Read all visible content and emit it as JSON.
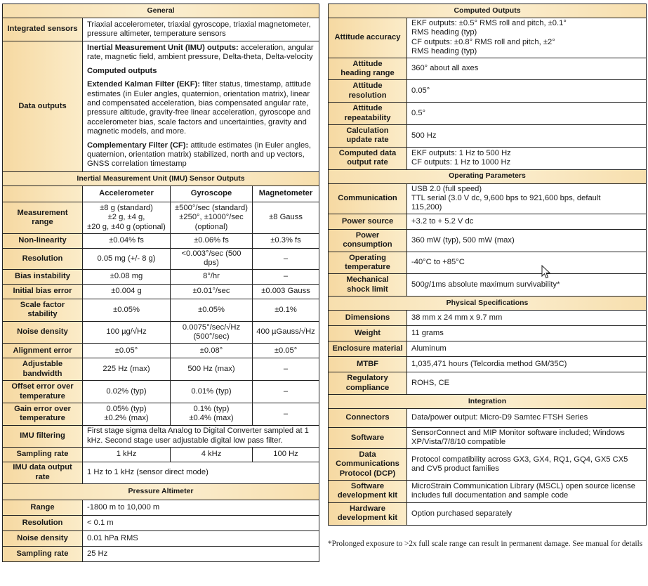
{
  "left": {
    "general": {
      "title": "General",
      "integrated_sensors": {
        "label": "Integrated sensors",
        "value": "Triaxial accelerometer, triaxial gyroscope, triaxial magnetometer, pressure altimeter, temperature sensors"
      },
      "data_outputs": {
        "label": "Data outputs",
        "imu_bold": "Inertial Measurement Unit (IMU) outputs:",
        "imu_text": " acceleration, angular rate, magnetic field, ambient pressure, Delta-theta, Delta-velocity",
        "computed_heading": "Computed outputs",
        "ekf_bold": "Extended Kalman Filter (EKF):",
        "ekf_text": " filter status, timestamp, attitude estimates (in Euler angles, quaternion, orientation matrix), linear and compensated acceleration, bias compensated angular rate, pressure altitude, gravity-free linear acceleration, gyroscope and accelerometer bias, scale factors and uncertainties, gravity and magnetic models, and more.",
        "cf_bold": "Complementary Filter (CF):",
        "cf_text": " attitude estimates (in Euler angles, quaternion, orientation matrix) stabilized, north and up vectors, GNSS correlation timestamp"
      }
    },
    "imu": {
      "title": "Inertial Measurement Unit (IMU) Sensor Outputs",
      "columns": [
        "Accelerometer",
        "Gyroscope",
        "Magnetometer"
      ],
      "rows": [
        {
          "label": "Measurement range",
          "acc": "±8 g (standard)\n±2 g, ±4 g,\n±20 g, ±40 g (optional)",
          "gyro": "±500°/sec (standard)\n±250°, ±1000°/sec\n(optional)",
          "mag": "±8 Gauss"
        },
        {
          "label": "Non-linearity",
          "acc": "±0.04% fs",
          "gyro": "±0.06% fs",
          "mag": "±0.3% fs"
        },
        {
          "label": "Resolution",
          "acc": "0.05 mg (+/- 8 g)",
          "gyro": "<0.003°/sec (500 dps)",
          "mag": "–"
        },
        {
          "label": "Bias instability",
          "acc": "±0.08 mg",
          "gyro": "8°/hr",
          "mag": "–"
        },
        {
          "label": "Initial bias error",
          "acc": "±0.004 g",
          "gyro": "±0.01°/sec",
          "mag": "±0.003 Gauss"
        },
        {
          "label": "Scale factor\nstability",
          "acc": "±0.05%",
          "gyro": "±0.05%",
          "mag": "±0.1%"
        },
        {
          "label": "Noise density",
          "acc": "100 µg/√Hz",
          "gyro": "0.0075°/sec/√Hz\n(500°/sec)",
          "mag": "400 µGauss/√Hz"
        },
        {
          "label": "Alignment error",
          "acc": "±0.05°",
          "gyro": "±0.08°",
          "mag": "±0.05°"
        },
        {
          "label": "Adjustable\nbandwidth",
          "acc": "225 Hz (max)",
          "gyro": "500 Hz (max)",
          "mag": "–"
        },
        {
          "label": "Offset error over\ntemperature",
          "acc": "0.02% (typ)",
          "gyro": "0.01% (typ)",
          "mag": "–"
        },
        {
          "label": "Gain error over\ntemperature",
          "acc": "0.05% (typ)\n±0.2% (max)",
          "gyro": "0.1% (typ)\n±0.4% (max)",
          "mag": "–"
        }
      ],
      "filtering": {
        "label": "IMU filtering",
        "value": "First stage sigma delta Analog to Digital Converter sampled at 1 kHz. Second stage user adjustable digital low pass filter."
      },
      "sampling": {
        "label": "Sampling rate",
        "acc": "1 kHz",
        "gyro": "4 kHz",
        "mag": "100 Hz"
      },
      "output_rate": {
        "label": "IMU data output\nrate",
        "value": "1 Hz to 1 kHz (sensor direct mode)"
      }
    },
    "pressure": {
      "title": "Pressure Altimeter",
      "rows": [
        {
          "label": "Range",
          "value": "-1800 m to 10,000 m"
        },
        {
          "label": "Resolution",
          "value": "< 0.1 m"
        },
        {
          "label": "Noise density",
          "value": "0.01 hPa RMS"
        },
        {
          "label": "Sampling rate",
          "value": "25 Hz"
        }
      ]
    }
  },
  "right": {
    "computed": {
      "title": "Computed Outputs",
      "rows": [
        {
          "label": "Attitude accuracy",
          "value": "EKF outputs: ±0.5° RMS roll and pitch, ±0.1°\nRMS heading (typ)\nCF outputs: ±0.8° RMS roll and pitch, ±2°\nRMS heading (typ)"
        },
        {
          "label": "Attitude\nheading range",
          "value": "360° about all axes"
        },
        {
          "label": "Attitude\nresolution",
          "value": "0.05°"
        },
        {
          "label": "Attitude\nrepeatability",
          "value": "0.5°"
        },
        {
          "label": "Calculation\nupdate rate",
          "value": "500 Hz"
        },
        {
          "label": "Computed data\noutput rate",
          "value": "EKF outputs: 1 Hz to 500 Hz\nCF outputs: 1 Hz to 1000 Hz"
        }
      ]
    },
    "operating": {
      "title": "Operating Parameters",
      "rows": [
        {
          "label": "Communication",
          "value": "USB 2.0 (full speed)\nTTL serial (3.0 V dc, 9,600 bps to 921,600 bps, default\n115,200)"
        },
        {
          "label": "Power source",
          "value": "+3.2 to + 5.2 V dc"
        },
        {
          "label": "Power\nconsumption",
          "value": "360 mW (typ), 500 mW (max)"
        },
        {
          "label": "Operating\ntemperature",
          "value": "-40°C to +85°C"
        },
        {
          "label": "Mechanical\nshock limit",
          "value": "500g/1ms absolute maximum survivability*"
        }
      ]
    },
    "physical": {
      "title": "Physical Specifications",
      "rows": [
        {
          "label": "Dimensions",
          "value": "38 mm x 24 mm x 9.7 mm"
        },
        {
          "label": "Weight",
          "value": "11 grams"
        },
        {
          "label": "Enclosure material",
          "value": "Aluminum"
        },
        {
          "label": "MTBF",
          "value": "1,035,471 hours (Telcordia method GM/35C)"
        },
        {
          "label": "Regulatory\ncompliance",
          "value": "ROHS, CE"
        }
      ]
    },
    "integration": {
      "title": "Integration",
      "rows": [
        {
          "label": "Connectors",
          "value": "Data/power output: Micro-D9 Samtec FTSH Series"
        },
        {
          "label": "Software",
          "value": "SensorConnect and MIP Monitor software included; Windows XP/Vista/7/8/10 compatible"
        },
        {
          "label": "Data\nCommunications\nProtocol (DCP)",
          "value": "Protocol compatibility across GX3, GX4, RQ1, GQ4, GX5 CX5 and CV5 product families"
        },
        {
          "label": "Software\ndevelopment kit",
          "value": "MicroStrain Communication Library (MSCL) open source license includes full documentation and sample code"
        },
        {
          "label": "Hardware\ndevelopment kit",
          "value": "Option purchased separately"
        }
      ]
    },
    "footnote": "*Prolonged exposure to >2x full scale range can result in permanent damage. See manual for details"
  },
  "icons": {
    "cursor": "mouse-pointer-icon"
  }
}
